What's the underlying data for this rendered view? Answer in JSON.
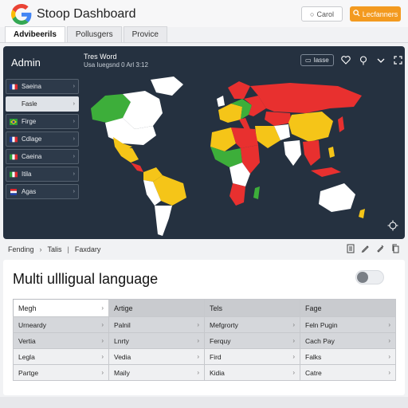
{
  "header": {
    "title": "Stoop Dashboard",
    "cancel_label": "Carol",
    "action_label": "Lecfanners",
    "logo_icon": "google-g-logo",
    "brand_colors": [
      "#4285F4",
      "#EA4335",
      "#FBBC05",
      "#34A853"
    ],
    "accent": "#F39A1F"
  },
  "tabs": [
    {
      "label": "Advibeerils",
      "active": true
    },
    {
      "label": "Pollusgers",
      "active": false
    },
    {
      "label": "Provice",
      "active": false
    }
  ],
  "map_panel": {
    "title": "Admin",
    "caption_1": "Tres Word",
    "caption_2": "Usa Iuegsnd 0 Arl 3:12",
    "chip_label": "Iasse",
    "background": "#253140",
    "list": [
      {
        "label": "Saeina",
        "flag": "france-flag",
        "active": false
      },
      {
        "label": "Fasle",
        "flag": "none",
        "active": true
      },
      {
        "label": "Firge",
        "flag": "brazil-flag",
        "active": false
      },
      {
        "label": "Cdlage",
        "flag": "france-flag",
        "active": false
      },
      {
        "label": "Caeina",
        "flag": "mexico-flag",
        "active": false
      },
      {
        "label": "Itila",
        "flag": "italy-flag",
        "active": false
      },
      {
        "label": "Agas",
        "flag": "netherlands-flag",
        "active": false
      }
    ],
    "region_colors": {
      "red": "#E8302F",
      "yellow": "#F5C518",
      "green": "#3DAE3A",
      "white": "#FFFFFF",
      "orange": "#F39A1F"
    }
  },
  "breadcrumb": {
    "items": [
      "Fending",
      "Talis",
      "Faxdary"
    ]
  },
  "card": {
    "title": "Multi ullligual language",
    "toggle_on": false,
    "header_row": [
      "Megh",
      "Artige",
      "Tels",
      "Fage"
    ],
    "rows": [
      [
        "Urneardy",
        "Palnil",
        "Mefgrorty",
        "Feln Pugin"
      ],
      [
        "Vertia",
        "Lnrty",
        "Ferquy",
        "Cach Pay"
      ],
      [
        "Legla",
        "Vedia",
        "Fird",
        "Falks"
      ],
      [
        "Partge",
        "Maily",
        "Kidia",
        "Catre"
      ]
    ]
  }
}
